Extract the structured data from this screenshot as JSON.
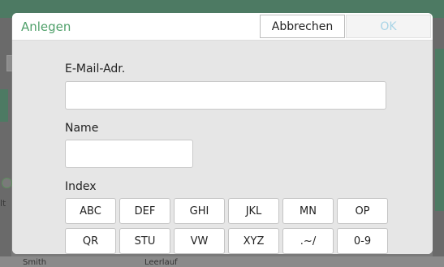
{
  "background": {
    "alt_text": "lt",
    "bottom_left_text": "Smith",
    "bottom_mid_text": "Leerlauf"
  },
  "dialog": {
    "title": "Anlegen",
    "cancel_label": "Abbrechen",
    "ok_label": "OK",
    "email_label": "E-Mail-Adr.",
    "email_value": "",
    "name_label": "Name",
    "name_value": "",
    "index_label": "Index",
    "index_buttons": [
      "ABC",
      "DEF",
      "GHI",
      "JKL",
      "MN",
      "OP",
      "QR",
      "STU",
      "VW",
      "XYZ",
      ".~/",
      "0-9"
    ]
  },
  "colors": {
    "title_green": "#4fa06a",
    "ok_disabled": "#a8d4e6",
    "body_grey": "#e6e6e6"
  }
}
